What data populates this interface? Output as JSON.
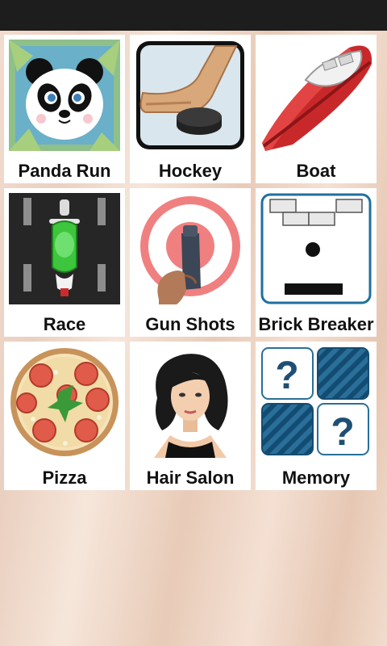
{
  "games": [
    {
      "label": "Panda Run",
      "icon": "panda-icon"
    },
    {
      "label": "Hockey",
      "icon": "hockey-icon"
    },
    {
      "label": "Boat",
      "icon": "boat-icon"
    },
    {
      "label": "Race",
      "icon": "motorbike-icon"
    },
    {
      "label": "Gun Shots",
      "icon": "gun-target-icon"
    },
    {
      "label": "Brick Breaker",
      "icon": "brick-breaker-icon"
    },
    {
      "label": "Pizza",
      "icon": "pizza-icon"
    },
    {
      "label": "Hair Salon",
      "icon": "woman-portrait-icon"
    },
    {
      "label": "Memory",
      "icon": "memory-cards-icon"
    }
  ]
}
